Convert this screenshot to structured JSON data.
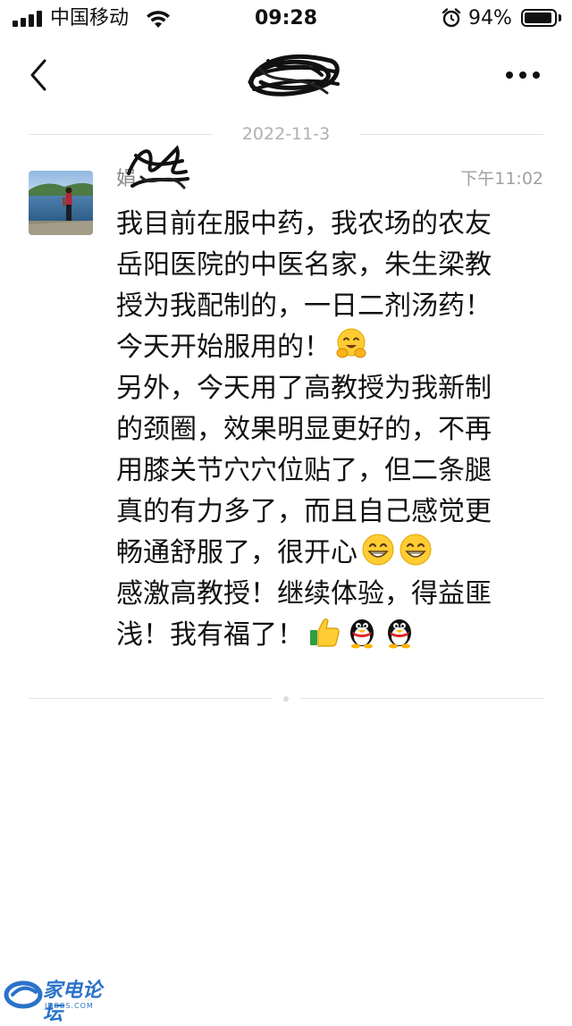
{
  "status_bar": {
    "carrier": "中国移动",
    "time": "09:28",
    "battery_percent": "94%",
    "battery_level": 0.94,
    "icons": [
      "signal-icon",
      "wifi-icon",
      "alarm-icon",
      "battery-icon"
    ]
  },
  "nav": {
    "back_icon": "chevron-left-icon",
    "title_redacted": true,
    "more_icon": "ellipsis-icon"
  },
  "date_divider": "2022-11-3",
  "message": {
    "sender": "娟",
    "time": "下午11:02",
    "lines": [
      "我目前在服中药，我农场的农友",
      "岳阳医院的中医名家，朱生梁教",
      "授为我配制的，一日二剂汤药！",
      "今天开始服用的！",
      "另外，今天用了高教授为我新制",
      "的颈圈，效果明显更好的，不再",
      "用膝关节穴穴位贴了，但二条腿",
      "真的有力多了，而且自己感觉更",
      "畅通舒服了，很开心",
      "感激高教授！继续体验，得益匪",
      "浅！我有福了！"
    ],
    "emojis": {
      "line4": [
        "hug-emoji"
      ],
      "line9": [
        "grin-emoji",
        "grin-emoji"
      ],
      "line11": [
        "thumbs-up-emoji",
        "penguin-emoji",
        "penguin-emoji"
      ]
    }
  },
  "watermark": {
    "text": "家电论坛",
    "sub": "JDBBS.COM"
  },
  "colors": {
    "background": "#ffffff",
    "text": "#111111",
    "meta_text": "#a0a0a0",
    "divider": "#e3e3e3",
    "watermark": "#2b72c9"
  }
}
